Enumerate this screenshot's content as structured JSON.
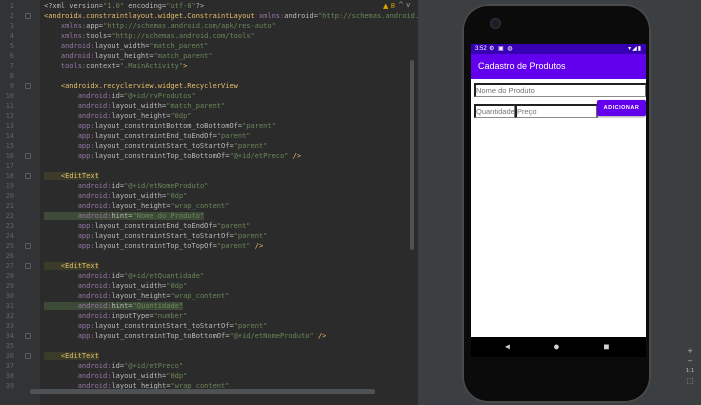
{
  "editor": {
    "warning_count": "▲ 8",
    "nav_arrows": "^ v",
    "lines": [
      {
        "n": "1",
        "segs": [
          [
            "attr",
            "<?xml version="
          ],
          [
            "val",
            "\"1.0\""
          ],
          [
            "attr",
            " encoding="
          ],
          [
            "val",
            "\"utf-8\""
          ],
          [
            "attr",
            "?>"
          ]
        ]
      },
      {
        "n": "2",
        "segs": [
          [
            "tag",
            "<androidx.constraintlayout.widget.ConstraintLayout "
          ],
          [
            "ns",
            "xmlns:"
          ],
          [
            "attr",
            "android="
          ],
          [
            "val",
            "\"http://schemas.android.com/apk/res/andr"
          ]
        ]
      },
      {
        "n": "3",
        "segs": [
          [
            "ns",
            "    xmlns:"
          ],
          [
            "attr",
            "app="
          ],
          [
            "val",
            "\"http://schemas.android.com/apk/res-auto\""
          ]
        ]
      },
      {
        "n": "4",
        "segs": [
          [
            "ns",
            "    xmlns:"
          ],
          [
            "attr",
            "tools="
          ],
          [
            "val",
            "\"http://schemas.android.com/tools\""
          ]
        ]
      },
      {
        "n": "5",
        "segs": [
          [
            "ns",
            "    android:"
          ],
          [
            "attr",
            "layout_width="
          ],
          [
            "val",
            "\"match_parent\""
          ]
        ]
      },
      {
        "n": "6",
        "segs": [
          [
            "ns",
            "    android:"
          ],
          [
            "attr",
            "layout_height="
          ],
          [
            "val",
            "\"match_parent\""
          ]
        ]
      },
      {
        "n": "7",
        "segs": [
          [
            "ns",
            "    tools:"
          ],
          [
            "attr",
            "context="
          ],
          [
            "val",
            "\".MainActivity\""
          ],
          [
            "tag",
            ">"
          ]
        ]
      },
      {
        "n": "8",
        "segs": [
          [
            "attr",
            " "
          ]
        ]
      },
      {
        "n": "9",
        "segs": [
          [
            "tag",
            "    <androidx.recyclerview.widget.RecyclerView"
          ]
        ]
      },
      {
        "n": "10",
        "segs": [
          [
            "ns",
            "        android:"
          ],
          [
            "attr",
            "id="
          ],
          [
            "val",
            "\"@+id/rvProdutos\""
          ]
        ]
      },
      {
        "n": "11",
        "segs": [
          [
            "ns",
            "        android:"
          ],
          [
            "attr",
            "layout_width="
          ],
          [
            "val",
            "\"match_parent\""
          ]
        ]
      },
      {
        "n": "12",
        "segs": [
          [
            "ns",
            "        android:"
          ],
          [
            "attr",
            "layout_height="
          ],
          [
            "val",
            "\"0dp\""
          ]
        ]
      },
      {
        "n": "13",
        "segs": [
          [
            "ns",
            "        app:"
          ],
          [
            "attr",
            "layout_constraintBottom_toBottomOf="
          ],
          [
            "val",
            "\"parent\""
          ]
        ]
      },
      {
        "n": "14",
        "segs": [
          [
            "ns",
            "        app:"
          ],
          [
            "attr",
            "layout_constraintEnd_toEndOf="
          ],
          [
            "val",
            "\"parent\""
          ]
        ]
      },
      {
        "n": "15",
        "segs": [
          [
            "ns",
            "        app:"
          ],
          [
            "attr",
            "layout_constraintStart_toStartOf="
          ],
          [
            "val",
            "\"parent\""
          ]
        ]
      },
      {
        "n": "16",
        "segs": [
          [
            "ns",
            "        app:"
          ],
          [
            "attr",
            "layout_constraintTop_toBottomOf="
          ],
          [
            "val",
            "\"@+id/etPreco\""
          ],
          [
            "tag",
            " />"
          ]
        ]
      },
      {
        "n": "17",
        "segs": [
          [
            "attr",
            " "
          ]
        ]
      },
      {
        "n": "18",
        "segs": [
          [
            "tag",
            "    <EditText"
          ]
        ],
        "hl": true
      },
      {
        "n": "19",
        "segs": [
          [
            "ns",
            "        android:"
          ],
          [
            "attr",
            "id="
          ],
          [
            "val",
            "\"@+id/etNomeProduto\""
          ]
        ]
      },
      {
        "n": "20",
        "segs": [
          [
            "ns",
            "        android:"
          ],
          [
            "attr",
            "layout_width="
          ],
          [
            "val",
            "\"0dp\""
          ]
        ]
      },
      {
        "n": "21",
        "segs": [
          [
            "ns",
            "        android:"
          ],
          [
            "attr",
            "layout_height="
          ],
          [
            "val",
            "\"wrap_content\""
          ]
        ]
      },
      {
        "n": "22",
        "segs": [
          [
            "ns",
            "        android:"
          ],
          [
            "attr",
            "hint="
          ],
          [
            "val",
            "\"Nome do Produto\""
          ]
        ],
        "hl2": true
      },
      {
        "n": "23",
        "segs": [
          [
            "ns",
            "        app:"
          ],
          [
            "attr",
            "layout_constraintEnd_toEndOf="
          ],
          [
            "val",
            "\"parent\""
          ]
        ]
      },
      {
        "n": "24",
        "segs": [
          [
            "ns",
            "        app:"
          ],
          [
            "attr",
            "layout_constraintStart_toStartOf="
          ],
          [
            "val",
            "\"parent\""
          ]
        ]
      },
      {
        "n": "25",
        "segs": [
          [
            "ns",
            "        app:"
          ],
          [
            "attr",
            "layout_constraintTop_toTopOf="
          ],
          [
            "val",
            "\"parent\""
          ],
          [
            "tag",
            " />"
          ]
        ]
      },
      {
        "n": "26",
        "segs": [
          [
            "attr",
            " "
          ]
        ]
      },
      {
        "n": "27",
        "segs": [
          [
            "tag",
            "    <EditText"
          ]
        ],
        "hl": true
      },
      {
        "n": "28",
        "segs": [
          [
            "ns",
            "        android:"
          ],
          [
            "attr",
            "id="
          ],
          [
            "val",
            "\"@+id/etQuantidade\""
          ]
        ]
      },
      {
        "n": "29",
        "segs": [
          [
            "ns",
            "        android:"
          ],
          [
            "attr",
            "layout_width="
          ],
          [
            "val",
            "\"0dp\""
          ]
        ]
      },
      {
        "n": "30",
        "segs": [
          [
            "ns",
            "        android:"
          ],
          [
            "attr",
            "layout_height="
          ],
          [
            "val",
            "\"wrap_content\""
          ]
        ]
      },
      {
        "n": "31",
        "segs": [
          [
            "ns",
            "        android:"
          ],
          [
            "attr",
            "hint="
          ],
          [
            "val",
            "\"Quantidade\""
          ]
        ],
        "hl2": true
      },
      {
        "n": "32",
        "segs": [
          [
            "ns",
            "        android:"
          ],
          [
            "attr",
            "inputType="
          ],
          [
            "val",
            "\"number\""
          ]
        ]
      },
      {
        "n": "33",
        "segs": [
          [
            "ns",
            "        app:"
          ],
          [
            "attr",
            "layout_constraintStart_toStartOf="
          ],
          [
            "val",
            "\"parent\""
          ]
        ]
      },
      {
        "n": "34",
        "segs": [
          [
            "ns",
            "        app:"
          ],
          [
            "attr",
            "layout_constraintTop_toBottomOf="
          ],
          [
            "val",
            "\"@+id/etNomeProduto\""
          ],
          [
            "tag",
            " />"
          ]
        ]
      },
      {
        "n": "35",
        "segs": [
          [
            "attr",
            " "
          ]
        ]
      },
      {
        "n": "36",
        "segs": [
          [
            "tag",
            "    <EditText"
          ]
        ],
        "hl": true
      },
      {
        "n": "37",
        "segs": [
          [
            "ns",
            "        android:"
          ],
          [
            "attr",
            "id="
          ],
          [
            "val",
            "\"@+id/etPreco\""
          ]
        ]
      },
      {
        "n": "38",
        "segs": [
          [
            "ns",
            "        android:"
          ],
          [
            "attr",
            "layout_width="
          ],
          [
            "val",
            "\"0dp\""
          ]
        ]
      },
      {
        "n": "39",
        "segs": [
          [
            "ns",
            "        android:"
          ],
          [
            "attr",
            "layout_height="
          ],
          [
            "val",
            "\"wrap_content\""
          ]
        ]
      }
    ]
  },
  "device": {
    "status_time": "3:52",
    "status_icons_left": "⚙ ▣ ◍",
    "status_icons_right": "▾◢▮",
    "app_title": "Cadastro de Produtos",
    "nome_placeholder": "Nome do Produto",
    "quantidade_placeholder": "Quantidade",
    "preco_placeholder": "Preço",
    "add_button": "ADICIONAR",
    "nav_back": "◀",
    "nav_home": "●",
    "nav_recent": "■"
  },
  "zoom": {
    "plus": "+",
    "minus": "−",
    "ratio": "1:1",
    "fit": "⬚"
  },
  "colors": {
    "primary": "#6200ee",
    "primary_dark": "#3700b3",
    "editor_bg": "#2b2b2b"
  }
}
